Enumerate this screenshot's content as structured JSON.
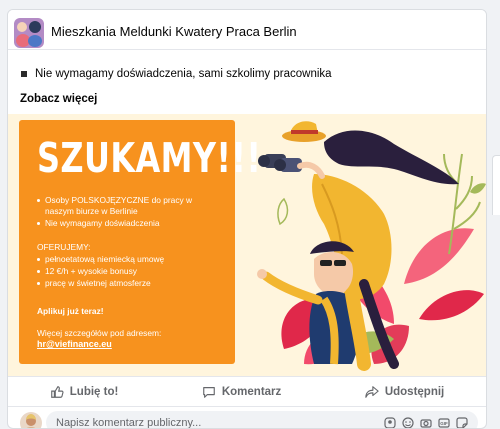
{
  "header": {
    "title": "Mieszkania Meldunki Kwatery Praca Berlin"
  },
  "post": {
    "bullet_text": "Nie wymagamy doświadczenia, sami szkolimy pracownika",
    "see_more": "Zobacz więcej"
  },
  "ad": {
    "headline": "SZUKAMY!!!",
    "bullets_1": [
      "Osoby POLSKOJĘZYCZNE do pracy w",
      "naszym biurze w Berlinie",
      "Nie wymagamy doświadczenia"
    ],
    "offer_title": "OFERUJEMY:",
    "offer_items": [
      "pełnoetatową niemiecką umowę",
      "12 €/h + wysokie bonusy",
      "pracę w świetnej atmosferze"
    ],
    "cta": "Aplikuj już teraz!",
    "more_info": "Więcej szczegółów pod adresem:",
    "email": "hr@viefinance.eu",
    "colors": {
      "panel": "#f7921e",
      "background": "#fff5dd",
      "coat": "#f2b630",
      "leaf_pink": "#f24a6b",
      "leaf_red": "#e0284a",
      "leaf_green": "#a4b95a"
    }
  },
  "actions": {
    "like": "Lubię to!",
    "comment": "Komentarz",
    "share": "Udostępnij"
  },
  "comment_box": {
    "placeholder": "Napisz komentarz publiczny..."
  },
  "icons": [
    "like-icon",
    "comment-icon",
    "share-icon",
    "sticker-icon",
    "emoji-icon",
    "camera-icon",
    "gif-icon",
    "avatar-sticker-icon"
  ]
}
